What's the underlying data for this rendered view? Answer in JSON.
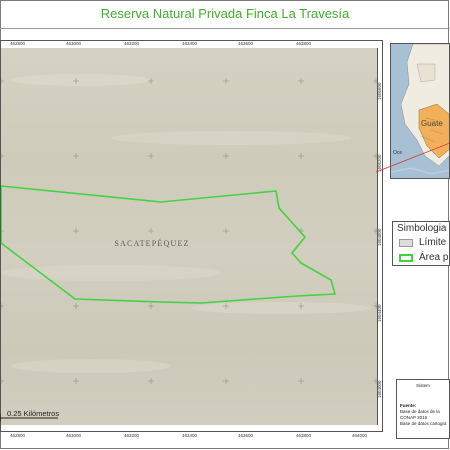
{
  "title": "Reserva Natural Privada Finca La Travesía",
  "map": {
    "top_ticks": [
      "462800",
      "463000",
      "463200",
      "463400",
      "463600",
      "463800"
    ],
    "bottom_ticks": [
      "462800",
      "463000",
      "463200",
      "463400",
      "463600",
      "463800",
      "464000"
    ],
    "right_ticks": [
      "1605600",
      "1605200",
      "1604800",
      "1604400",
      "1604000"
    ],
    "region_label": "SACATEPÉQUEZ",
    "scale_label": "0.25 Kilómetros"
  },
  "inset": {
    "region_label": "Guate",
    "sea_label": "Oce"
  },
  "legend": {
    "title": "Simbologia",
    "items": [
      {
        "label": "Límite",
        "fill": "#dcdcdc",
        "stroke": "#9a9a9a"
      },
      {
        "label": "Área pr",
        "fill": "#ffffff",
        "stroke": "#3fd43f"
      }
    ]
  },
  "info": {
    "lines": [
      "Sistem",
      "Fuente:",
      "Base de datos de la",
      "CONAP 2016",
      "Base de datos cartogra"
    ]
  },
  "colors": {
    "title": "#3fb02b",
    "polygon": "#3fd43f",
    "map_background": "#d3cfc1",
    "pointer": "#d33"
  }
}
